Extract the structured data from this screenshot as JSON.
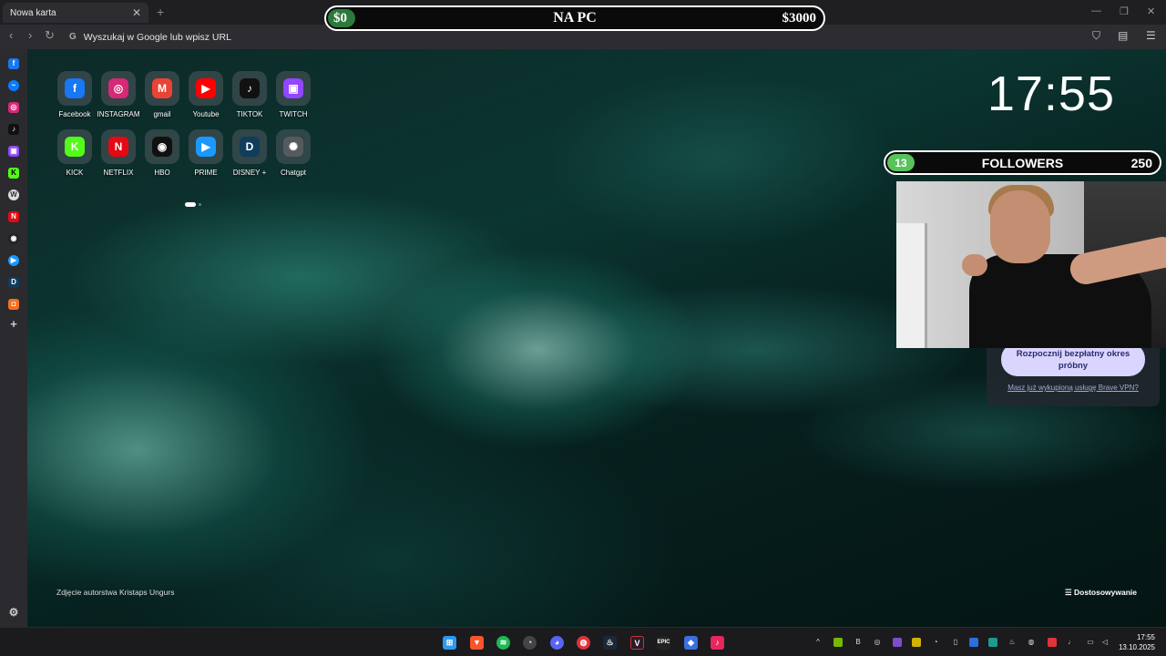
{
  "browser": {
    "tab_title": "Nowa karta",
    "tab_close": "✕",
    "new_tab": "+",
    "address_placeholder": "Wyszukaj w Google lub wpisz URL",
    "address_engine_glyph": "G"
  },
  "stream_overlay": {
    "goal_start": "$0",
    "goal_title": "NA PC",
    "goal_end": "$3000",
    "followers_count": "13",
    "followers_label": "FOLLOWERS",
    "followers_goal": "250",
    "goal_color": "#2b7a3b",
    "followers_color": "#58c35b"
  },
  "new_tab_page": {
    "clock": "17:55",
    "shortcuts": [
      {
        "label": "Facebook",
        "glyph": "f",
        "color": "#1877f2"
      },
      {
        "label": "INSTAGRAM",
        "glyph": "◎",
        "color": "#d62976"
      },
      {
        "label": "gmail",
        "glyph": "M",
        "color": "#ea4335"
      },
      {
        "label": "Youtube",
        "glyph": "▶",
        "color": "#ff0000"
      },
      {
        "label": "TIKTOK",
        "glyph": "♪",
        "color": "#111111"
      },
      {
        "label": "TWITCH",
        "glyph": "▣",
        "color": "#9146ff"
      },
      {
        "label": "KICK",
        "glyph": "K",
        "color": "#53fc18"
      },
      {
        "label": "NETFLIX",
        "glyph": "N",
        "color": "#e50914"
      },
      {
        "label": "HBO",
        "glyph": "◉",
        "color": "#111111"
      },
      {
        "label": "PRIME",
        "glyph": "▶",
        "color": "#1a98ff"
      },
      {
        "label": "DISNEY +",
        "glyph": "D",
        "color": "#113d5c"
      },
      {
        "label": "Chatgpt",
        "glyph": "✺",
        "color": "#555a5e"
      }
    ],
    "vpn_button": "Rozpocznij bezpłatny okres próbny",
    "vpn_link": "Masz już wykupioną usługę Brave VPN?",
    "photo_credit": "Zdjęcie autorstwa Kristaps Ungurs",
    "customize": "Dostosowywanie",
    "customize_glyph": "☰"
  },
  "taskbar": {
    "time": "17:55",
    "date": "13.10.2025"
  }
}
